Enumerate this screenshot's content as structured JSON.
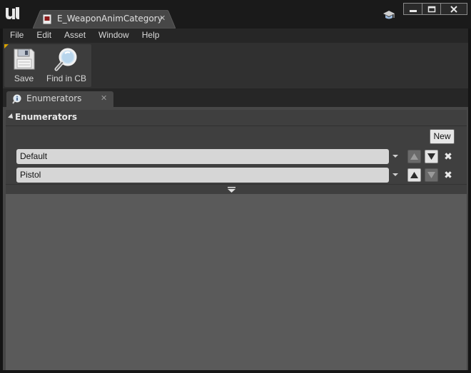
{
  "window": {
    "document_tab_title": "E_WeaponAnimCategory",
    "document_tab_close": "✕",
    "buttons": {
      "minimize": "minimize-icon",
      "maximize": "maximize-icon",
      "close": "close-icon"
    }
  },
  "menu": {
    "items": [
      "File",
      "Edit",
      "Asset",
      "Window",
      "Help"
    ]
  },
  "toolbar": {
    "save_label": "Save",
    "find_label": "Find in CB"
  },
  "panel": {
    "tab_title": "Enumerators",
    "tab_close": "✕"
  },
  "details": {
    "category_title": "Enumerators",
    "new_button_label": "New",
    "enumerators": [
      {
        "value": "Default",
        "move_up_enabled": false,
        "move_down_enabled": true,
        "delete_glyph": "✖"
      },
      {
        "value": "Pistol",
        "move_up_enabled": true,
        "move_down_enabled": false,
        "delete_glyph": "✖"
      }
    ]
  },
  "colors": {
    "background": "#151515",
    "panel": "#474747",
    "accent": "#d8a200",
    "input": "#d6d6d6"
  }
}
